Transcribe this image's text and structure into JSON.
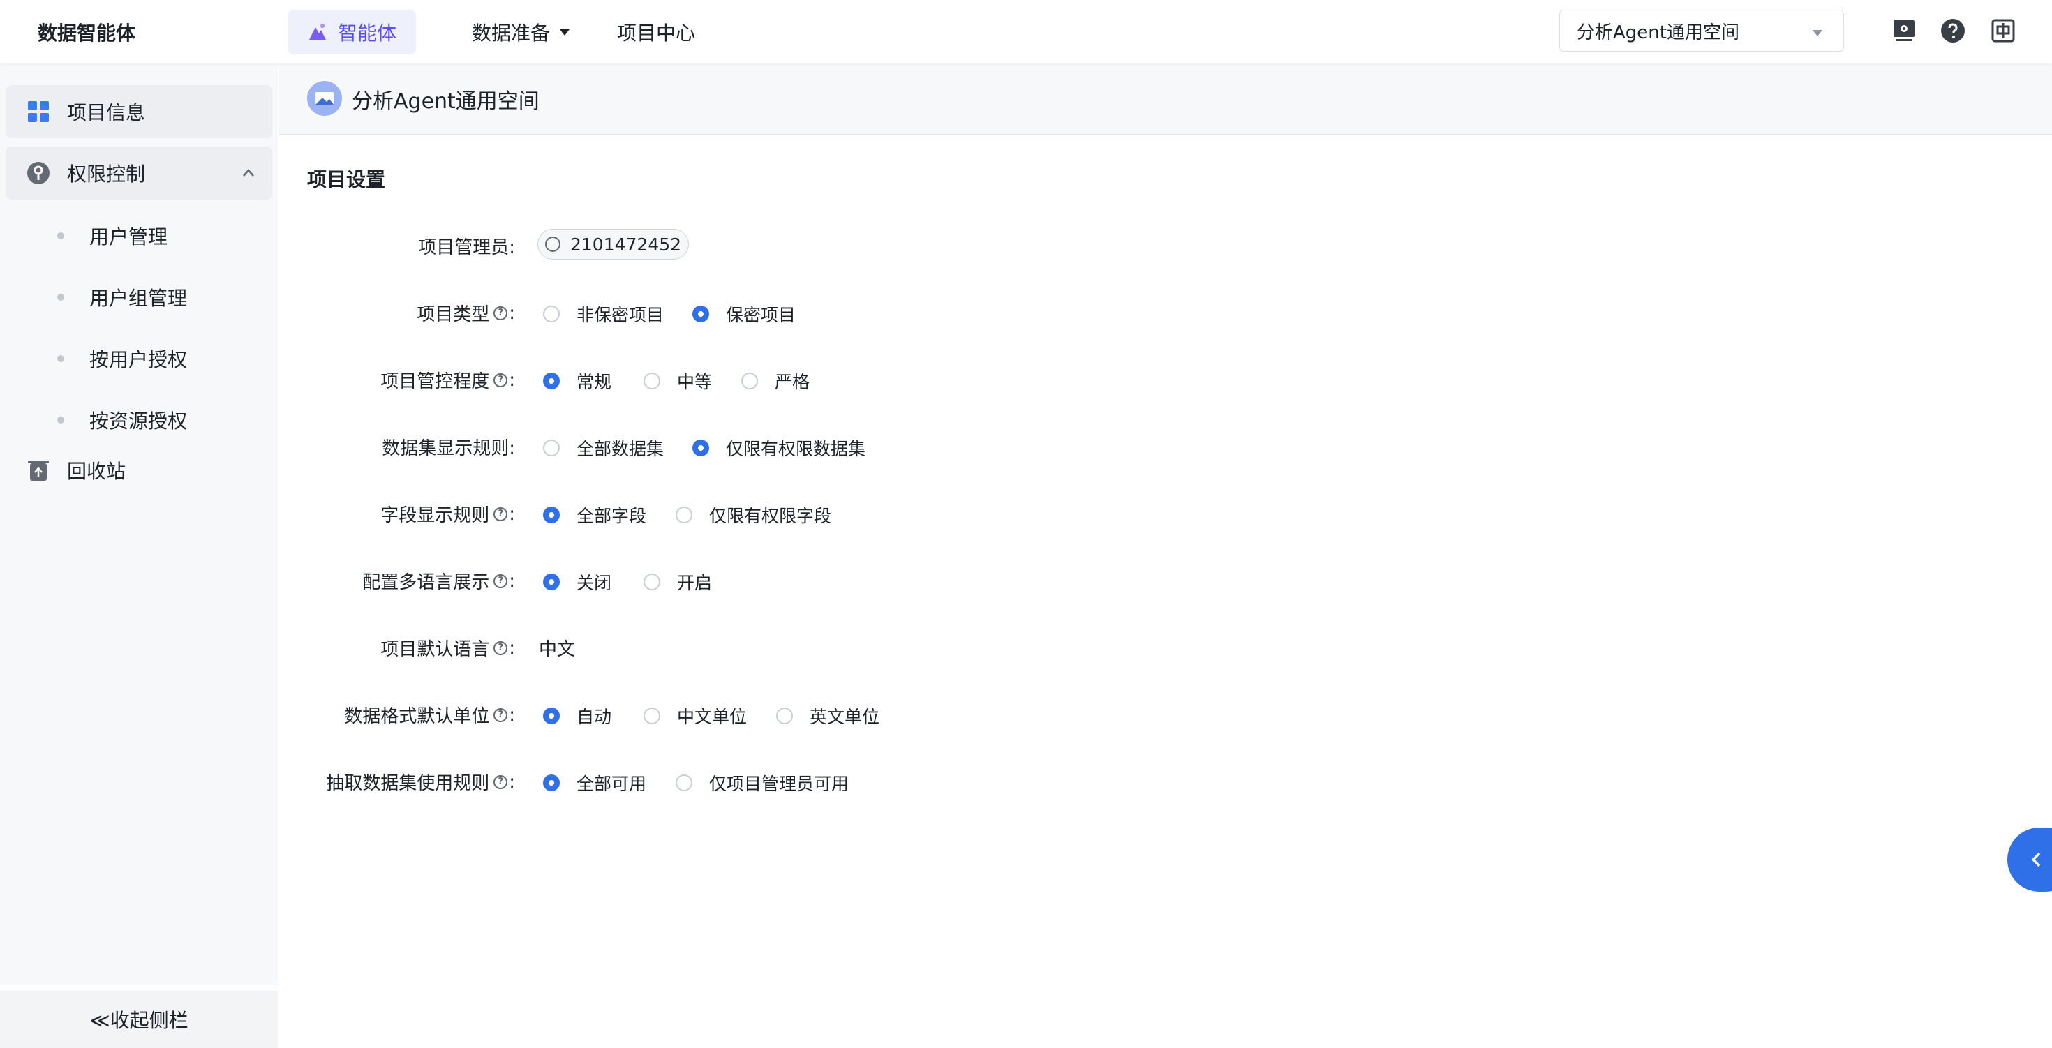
{
  "topbar": {
    "brand": "数据智能体",
    "nav": [
      {
        "label": "智能体"
      },
      {
        "label": "数据准备"
      },
      {
        "label": "项目中心"
      }
    ],
    "space_select": {
      "value": "分析Agent通用空间"
    },
    "icons": [
      "monitor-icon",
      "help-icon",
      "language-icon"
    ]
  },
  "sidebar": {
    "items": [
      {
        "label": "项目信息",
        "icon": "grid-icon"
      },
      {
        "label": "权限控制",
        "icon": "key-icon"
      },
      {
        "label": "回收站",
        "icon": "recycle-bin-icon"
      }
    ],
    "sub_items": [
      {
        "label": "用户管理"
      },
      {
        "label": "用户组管理"
      },
      {
        "label": "按用户授权"
      },
      {
        "label": "按资源授权"
      }
    ],
    "collapse_label": "≪收起侧栏"
  },
  "main": {
    "space_title": "分析Agent通用空间",
    "section_title": "项目设置",
    "settings": [
      {
        "label": "项目管理员:",
        "help": false,
        "admin": "2101472452"
      },
      {
        "label": "项目类型",
        "help": true,
        "options": [
          {
            "label": "非保密项目",
            "checked": false
          },
          {
            "label": "保密项目",
            "checked": true
          }
        ]
      },
      {
        "label": "项目管控程度",
        "help": true,
        "options": [
          {
            "label": "常规",
            "checked": true
          },
          {
            "label": "中等",
            "checked": false
          },
          {
            "label": "严格",
            "checked": false
          }
        ]
      },
      {
        "label": "数据集显示规则:",
        "help": false,
        "options": [
          {
            "label": "全部数据集",
            "checked": false
          },
          {
            "label": "仅限有权限数据集",
            "checked": true
          }
        ]
      },
      {
        "label": "字段显示规则",
        "help": true,
        "options": [
          {
            "label": "全部字段",
            "checked": true
          },
          {
            "label": "仅限有权限字段",
            "checked": false
          }
        ]
      },
      {
        "label": "配置多语言展示",
        "help": true,
        "options": [
          {
            "label": "关闭",
            "checked": true
          },
          {
            "label": "开启",
            "checked": false
          }
        ]
      },
      {
        "label": "项目默认语言",
        "help": true,
        "value": "中文"
      },
      {
        "label": "数据格式默认单位",
        "help": true,
        "options": [
          {
            "label": "自动",
            "checked": true
          },
          {
            "label": "中文单位",
            "checked": false
          },
          {
            "label": "英文单位",
            "checked": false
          }
        ]
      },
      {
        "label": "抽取数据集使用规则",
        "help": true,
        "options": [
          {
            "label": "全部可用",
            "checked": true
          },
          {
            "label": "仅项目管理员可用",
            "checked": false
          }
        ]
      }
    ],
    "help_glyph": "?",
    "help_colon": ":"
  },
  "colors": {
    "accent": "#2f6fe8",
    "agent_purple": "#5b4cf0",
    "sidebar_bg": "#f7f8fa"
  }
}
